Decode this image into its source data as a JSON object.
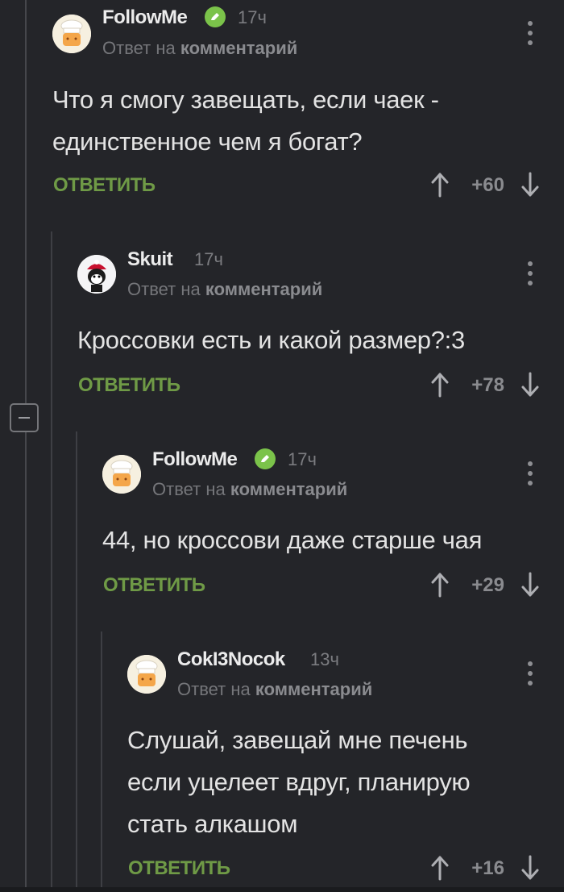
{
  "comments": [
    {
      "author": "FollowMe",
      "time": "17ч",
      "reply_prefix": "Ответ на",
      "reply_target": "комментарий",
      "text_lines": [
        "Что я смогу завещать, если чаек -",
        "единственное чем я богат?"
      ],
      "reply_label": "ОТВЕТИТЬ",
      "score": "+60",
      "verified": true,
      "avatar": "chef-hat-avatar"
    },
    {
      "author": "Skuit",
      "time": "17ч",
      "reply_prefix": "Ответ на",
      "reply_target": "комментарий",
      "text_lines": [
        "Кроссовки есть и какой размер?:3"
      ],
      "reply_label": "ОТВЕТИТЬ",
      "score": "+78",
      "verified": false,
      "avatar": "cartoon-character-avatar"
    },
    {
      "author": "FollowMe",
      "time": "17ч",
      "reply_prefix": "Ответ на",
      "reply_target": "комментарий",
      "text_lines": [
        "44, но кроссови даже старше чая"
      ],
      "reply_label": "ОТВЕТИТЬ",
      "score": "+29",
      "verified": true,
      "avatar": "chef-hat-avatar"
    },
    {
      "author": "CokI3Nocok",
      "time": "13ч",
      "reply_prefix": "Ответ на",
      "reply_target": "комментарий",
      "text_lines": [
        "Слушай, завещай мне печень",
        "если уцелеет вдруг, планирую",
        "стать алкашом"
      ],
      "reply_label": "ОТВЕТИТЬ",
      "score": "+16",
      "verified": false,
      "avatar": "chef-hat-avatar"
    }
  ],
  "colors": {
    "background": "#242529",
    "accent_green": "#6f9a46",
    "verified_badge": "#7bc34a"
  }
}
